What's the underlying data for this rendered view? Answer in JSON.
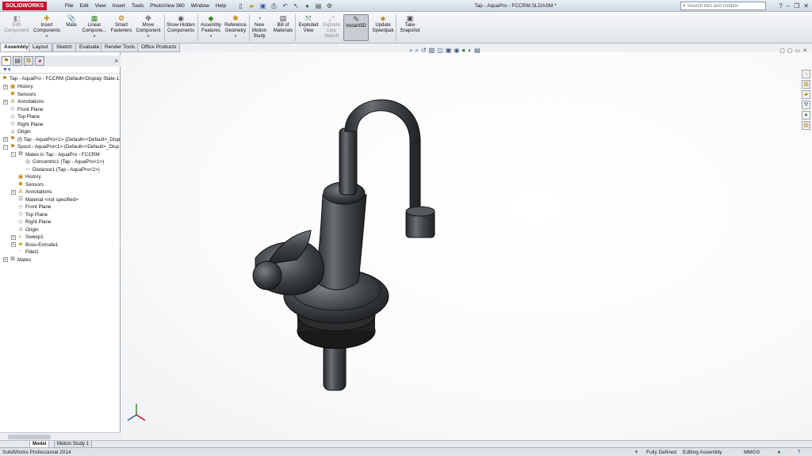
{
  "titlebar": {
    "logo": "SOLIDWORKS",
    "menu": [
      "File",
      "Edit",
      "View",
      "Insert",
      "Tools",
      "PhotoView 360",
      "Window",
      "Help"
    ],
    "window_title": "Tap - AquaPro - FCCRM.SLDASM *",
    "search_placeholder": "Search files and models"
  },
  "commands": {
    "edit_component": "Edit Component",
    "insert_components": "Insert Components",
    "mate": "Mate",
    "linear_component": "Linear Compone...",
    "smart_fasteners": "Smart Fasteners",
    "move_component": "Move Component",
    "show_hidden": "Show Hidden Components",
    "assembly_features": "Assembly Features",
    "reference_geometry": "Reference Geometry",
    "new_motion_study": "New Motion Study",
    "bill_of_materials": "Bill of Materials",
    "exploded_view": "Exploded View",
    "explode_line_sketch": "Explode Line Sketch",
    "instant3d": "Instant3D",
    "update_speedpak": "Update Speedpak",
    "take_snapshot": "Take Snapshot"
  },
  "tabs": [
    "Assembly",
    "Layout",
    "Sketch",
    "Evaluate",
    "Render Tools",
    "Office Products"
  ],
  "tree": {
    "root": "Tap - AquaPro - FCCRM  (Default<Display State-1",
    "history": "History",
    "sensors": "Sensors",
    "annotations": "Annotations",
    "front_plane": "Front Plane",
    "top_plane": "Top Plane",
    "right_plane": "Right Plane",
    "origin": "Origin",
    "tap_part": "(f) Tap - AquaPro<1> (Default<<Default>_Disp",
    "spout_part": "Spout - AquaPro<1> (Default<<Default>_Disp",
    "mates_in": "Mates in Tap - AquaPro - FCCRM",
    "concentric": "Concentric1 (Tap - AquaPro<1>)",
    "distance": "Distance1 (Tap - AquaPro<1>)",
    "s_history": "History",
    "s_sensors": "Sensors",
    "s_annotations": "Annotations",
    "s_material": "Material <not specified>",
    "s_front_plane": "Front Plane",
    "s_top_plane": "Top Plane",
    "s_right_plane": "Right Plane",
    "s_origin": "Origin",
    "sweep": "Sweep1",
    "boss_extrude": "Boss-Extrude1",
    "fillet": "Fillet1",
    "mates": "Mates"
  },
  "bottom_tabs": [
    "Model",
    "Motion Study 1"
  ],
  "status": {
    "product": "SolidWorks Professional 2014",
    "state": "Fully Defined",
    "mode": "Editing Assembly",
    "units": "MMGS"
  },
  "colors": {
    "model_body": "#3a3d40",
    "model_highlight": "#8a8e93",
    "accent": "#c8102e"
  }
}
